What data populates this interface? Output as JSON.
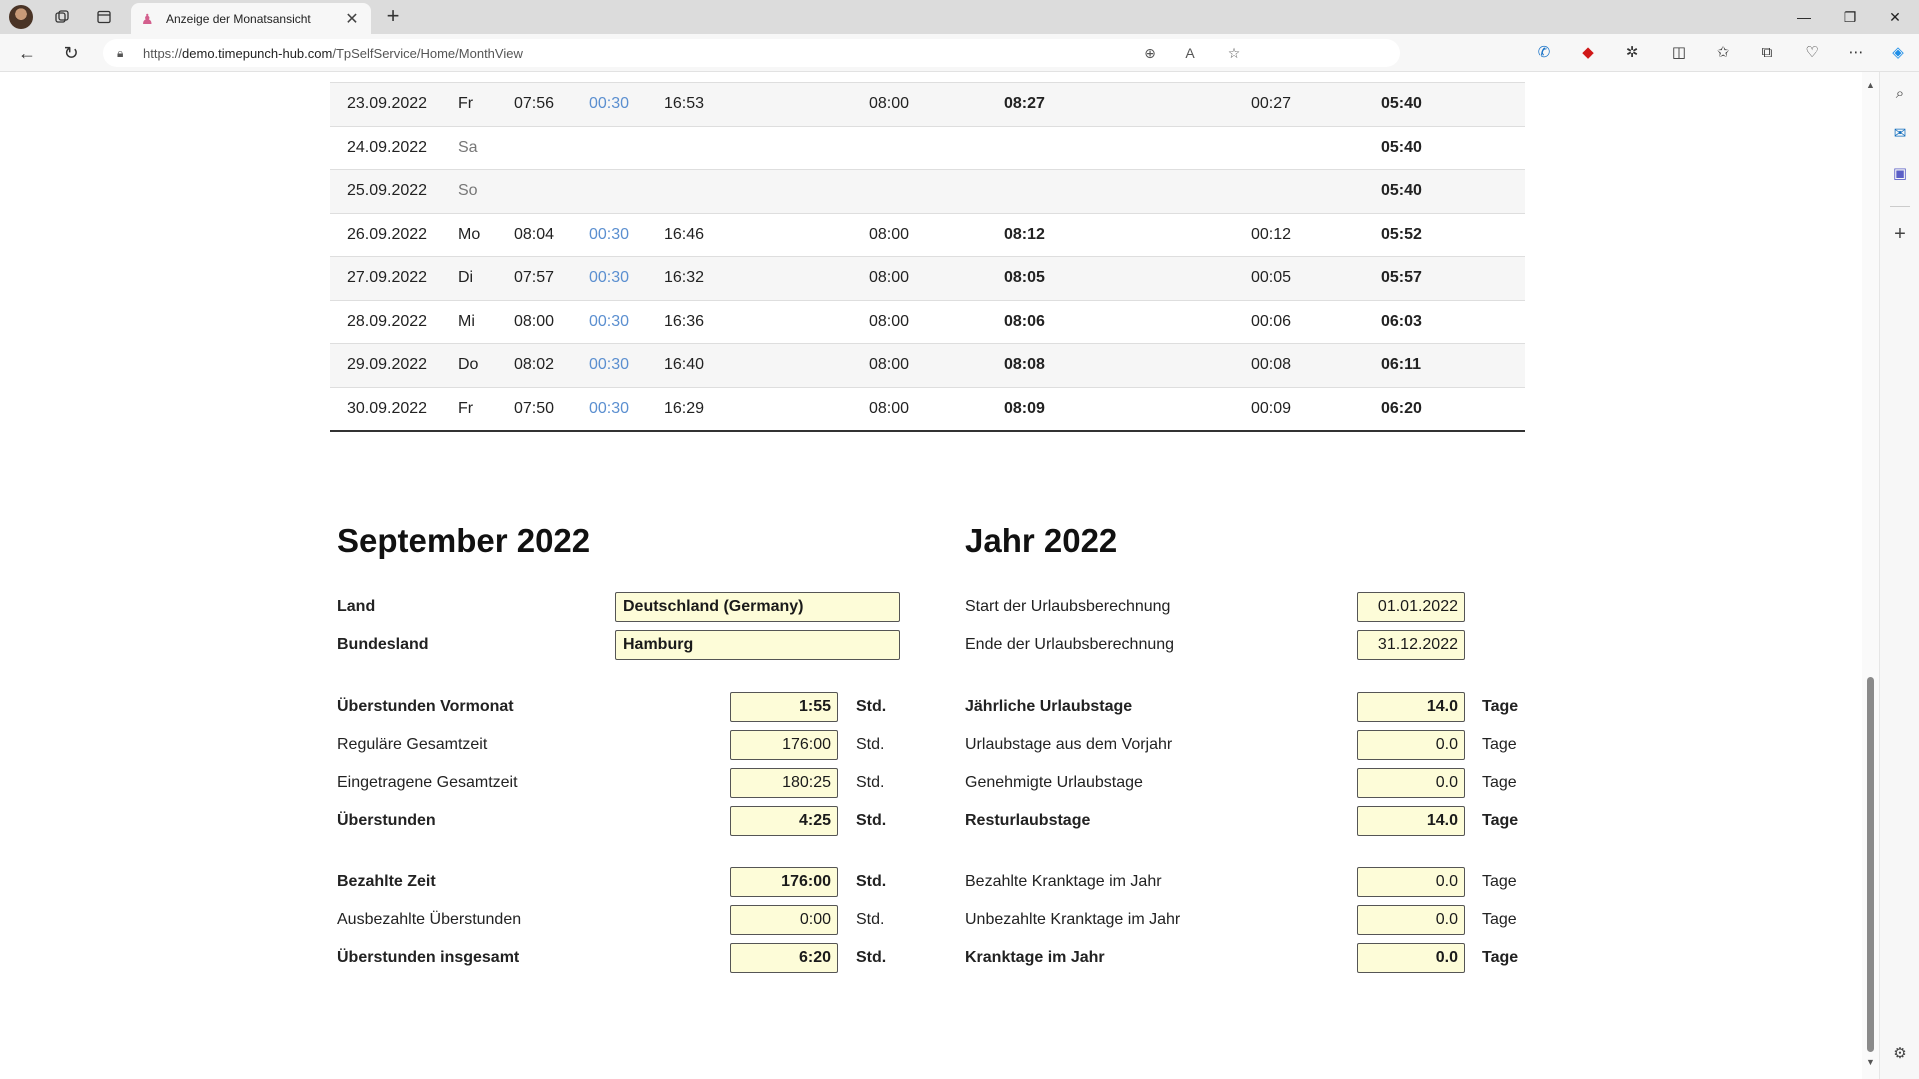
{
  "browser": {
    "tab_title": "Anzeige der Monatsansicht",
    "url_prefix": "https://",
    "url_host": "demo.timepunch-hub.com",
    "url_path": "/TpSelfService/Home/MonthView"
  },
  "table": {
    "rows": [
      {
        "date": "23.09.2022",
        "day": "Fr",
        "in": "07:56",
        "pause": "00:30",
        "out": "16:53",
        "plan": "08:00",
        "actual": "08:27",
        "diff": "00:27",
        "balance": "05:40",
        "weekend": false
      },
      {
        "date": "24.09.2022",
        "day": "Sa",
        "in": "",
        "pause": "",
        "out": "",
        "plan": "",
        "actual": "",
        "diff": "",
        "balance": "05:40",
        "weekend": true
      },
      {
        "date": "25.09.2022",
        "day": "So",
        "in": "",
        "pause": "",
        "out": "",
        "plan": "",
        "actual": "",
        "diff": "",
        "balance": "05:40",
        "weekend": true
      },
      {
        "date": "26.09.2022",
        "day": "Mo",
        "in": "08:04",
        "pause": "00:30",
        "out": "16:46",
        "plan": "08:00",
        "actual": "08:12",
        "diff": "00:12",
        "balance": "05:52",
        "weekend": false
      },
      {
        "date": "27.09.2022",
        "day": "Di",
        "in": "07:57",
        "pause": "00:30",
        "out": "16:32",
        "plan": "08:00",
        "actual": "08:05",
        "diff": "00:05",
        "balance": "05:57",
        "weekend": false
      },
      {
        "date": "28.09.2022",
        "day": "Mi",
        "in": "08:00",
        "pause": "00:30",
        "out": "16:36",
        "plan": "08:00",
        "actual": "08:06",
        "diff": "00:06",
        "balance": "06:03",
        "weekend": false
      },
      {
        "date": "29.09.2022",
        "day": "Do",
        "in": "08:02",
        "pause": "00:30",
        "out": "16:40",
        "plan": "08:00",
        "actual": "08:08",
        "diff": "00:08",
        "balance": "06:11",
        "weekend": false
      },
      {
        "date": "30.09.2022",
        "day": "Fr",
        "in": "07:50",
        "pause": "00:30",
        "out": "16:29",
        "plan": "08:00",
        "actual": "08:09",
        "diff": "00:09",
        "balance": "06:20",
        "weekend": false
      }
    ]
  },
  "month": {
    "title": "September 2022",
    "land_label": "Land",
    "land_value": "Deutschland (Germany)",
    "bundesland_label": "Bundesland",
    "bundesland_value": "Hamburg",
    "rows": [
      {
        "label": "Überstunden Vormonat",
        "value": "1:55",
        "unit": "Std.",
        "bold": true
      },
      {
        "label": "Reguläre Gesamtzeit",
        "value": "176:00",
        "unit": "Std.",
        "bold": false
      },
      {
        "label": "Eingetragene Gesamtzeit",
        "value": "180:25",
        "unit": "Std.",
        "bold": false
      },
      {
        "label": "Überstunden",
        "value": "4:25",
        "unit": "Std.",
        "bold": true
      },
      {
        "label": "Bezahlte Zeit",
        "value": "176:00",
        "unit": "Std.",
        "bold": true
      },
      {
        "label": "Ausbezahlte Überstunden",
        "value": "0:00",
        "unit": "Std.",
        "bold": false
      },
      {
        "label": "Überstunden insgesamt",
        "value": "6:20",
        "unit": "Std.",
        "bold": true
      }
    ]
  },
  "year": {
    "title": "Jahr 2022",
    "start_label": "Start der Urlaubsberechnung",
    "start_value": "01.01.2022",
    "end_label": "Ende der Urlaubsberechnung",
    "end_value": "31.12.2022",
    "rows": [
      {
        "label": "Jährliche Urlaubstage",
        "value": "14.0",
        "unit": "Tage",
        "bold": true
      },
      {
        "label": "Urlaubstage aus dem Vorjahr",
        "value": "0.0",
        "unit": "Tage",
        "bold": false
      },
      {
        "label": "Genehmigte Urlaubstage",
        "value": "0.0",
        "unit": "Tage",
        "bold": false
      },
      {
        "label": "Resturlaubstage",
        "value": "14.0",
        "unit": "Tage",
        "bold": true
      },
      {
        "label": "Bezahlte Kranktage im Jahr",
        "value": "0.0",
        "unit": "Tage",
        "bold": false
      },
      {
        "label": "Unbezahlte Kranktage im Jahr",
        "value": "0.0",
        "unit": "Tage",
        "bold": false
      },
      {
        "label": "Kranktage im Jahr",
        "value": "0.0",
        "unit": "Tage",
        "bold": true
      }
    ]
  }
}
